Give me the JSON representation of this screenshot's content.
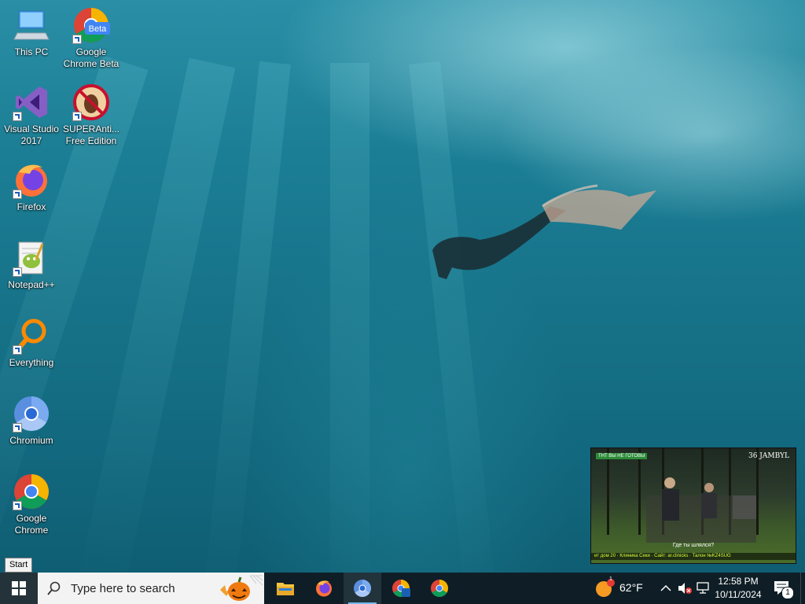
{
  "desktop_icons": [
    {
      "label": "This PC",
      "icon": "computer-icon"
    },
    {
      "label": "Google Chrome Beta",
      "icon": "chrome-beta-icon"
    },
    {
      "label": "Visual Studio 2017",
      "icon": "visual-studio-icon"
    },
    {
      "label": "SUPERAnti... Free Edition",
      "icon": "superantispyware-icon"
    },
    {
      "label": "Firefox",
      "icon": "firefox-icon"
    },
    {
      "label": "Notepad++",
      "icon": "notepad-plus-plus-icon"
    },
    {
      "label": "Everything",
      "icon": "everything-search-icon"
    },
    {
      "label": "Chromium",
      "icon": "chromium-icon"
    },
    {
      "label": "Google Chrome",
      "icon": "chrome-icon"
    }
  ],
  "chrome_beta_badge": "Beta",
  "tooltip": "Start",
  "taskbar": {
    "search_placeholder": "Type here to search",
    "pinned": [
      {
        "name": "file-explorer",
        "icon": "folder-icon"
      },
      {
        "name": "firefox",
        "icon": "firefox-icon"
      },
      {
        "name": "chromium",
        "icon": "chromium-icon"
      },
      {
        "name": "chrome-beta",
        "icon": "chrome-beta-icon"
      },
      {
        "name": "chrome",
        "icon": "chrome-icon"
      }
    ],
    "weather": {
      "temp": "62°F",
      "badge": "1"
    },
    "clock": {
      "time": "12:58 PM",
      "date": "10/11/2024"
    },
    "notifications_count": "1"
  },
  "video_popup": {
    "channel_tag": "ТНТ ВЫ НЕ ГОТОВЫ",
    "logo": "36 JAMBYL",
    "subtitle": "Где ты шлялся?",
    "ticker": "ит дом 20 · Клиника Секи · Сайт: ar.clinicks · Талон №KZ4SUG"
  },
  "colors": {
    "taskbar_bg": "#0f1e26",
    "search_bg": "#f3f3f3",
    "accent": "#76b9ed"
  }
}
